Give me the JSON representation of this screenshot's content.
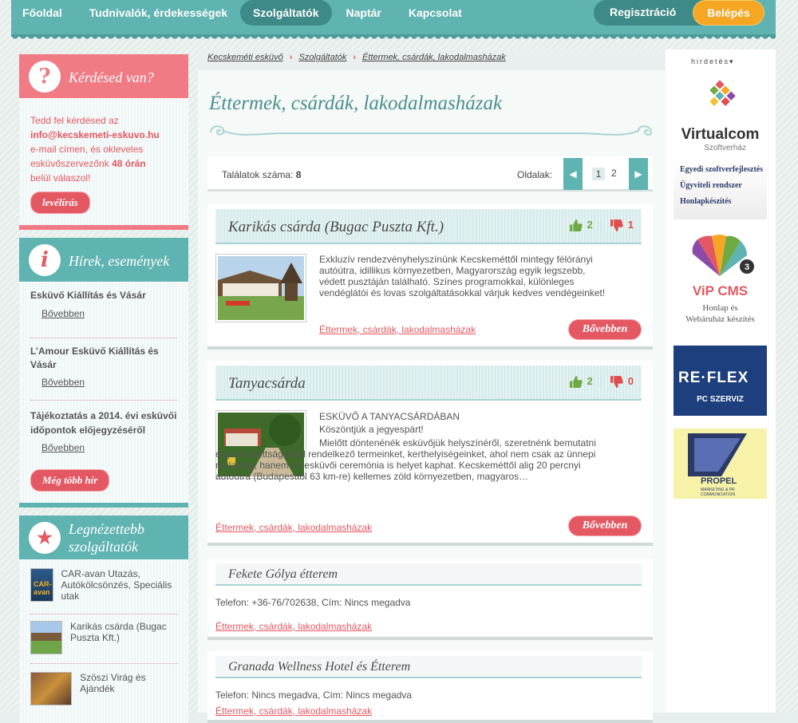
{
  "nav": {
    "items": [
      "Főoldal",
      "Tudnivalók, érdekességek",
      "Szolgáltatók",
      "Naptár",
      "Kapcsolat"
    ],
    "register": "Regisztráció",
    "login": "Belépés"
  },
  "question": {
    "title": "Kérdésed van?",
    "text1": "Tedd fel kérdésed az",
    "email": "info@kecskemeti-eskuvo.hu",
    "text2": "e-mail címen, és okleveles esküvőszervezőnk",
    "hours": "48 órán",
    "text3": "belül válaszol!",
    "button": "levélírás"
  },
  "news": {
    "title": "Hírek, események",
    "items": [
      {
        "title": "Esküvő Kiállítás és Vásár",
        "more": "Bővebben"
      },
      {
        "title": "L’Amour Esküvő Kiállítás és Vásár",
        "more": "Bővebben"
      },
      {
        "title": "Tájékoztatás a 2014. évi esküvői időpontok előjegyzéséről",
        "more": "Bővebben"
      }
    ],
    "button": "Még több hír"
  },
  "popular": {
    "title1": "Legnézettebb",
    "title2": "szolgáltatók",
    "items": [
      "CAR-avan Utazás, Autókölcsönzés, Speciális utak",
      "Karikás csárda (Bugac Puszta Kft.)",
      "Szöszi Virág és Ajándék"
    ]
  },
  "breadcrumb": [
    "Kecskeméti esküvő",
    "Szolgáltatók",
    "Éttermek, csárdák, lakodalmasházak"
  ],
  "page_title": "Éttermek, csárdák, lakodalmasházak",
  "results": {
    "label": "Találatok száma:",
    "count": "8",
    "pages_label": "Oldalak:",
    "pages": [
      "1",
      "2"
    ]
  },
  "listings": [
    {
      "name": "Karikás csárda (Bugac Puszta Kft.)",
      "up": "2",
      "down": "1",
      "desc": "Exkluzív rendezvényhelyszínünk Kecskeméttől mintegy félórányi autóútra, idillikus környezetben, Magyarország egyik legszebb, védett pusztáján található. Színes programokkal, különleges vendéglátói és lovas szolgáltatásokkal várjuk kedves vendégeinket!",
      "category": "Éttermek, csárdák, lakodalmasházak",
      "more": "Bővebben"
    },
    {
      "name": "Tanyacsárda",
      "up": "2",
      "down": "0",
      "heading": "ESKÜVŐ A TANYACSÁRDÁBAN",
      "sub": "Köszöntjük a jegyespárt!",
      "desc": "Mielőtt döntenénék esküvőjük helyszínéről, szeretnénk bemutatni egyedi adottságokkal rendelkező termeinket, kerthelyiségeinket, ahol nem csak az ünnepi mulatság, hanem az esküvői ceremónia is helyet kaphat. Kecskeméttől alig 20 percnyi autóútra (Budapesttől 63 km-re) kellemes zöld környezetben, magyaros…",
      "category": "Éttermek, csárdák, lakodalmasházak",
      "more": "Bővebben"
    },
    {
      "name": "Fekete Gólya étterem",
      "info": "Telefon: +36-76/702638, Cím: Nincs megadva",
      "category": "Éttermek, csárdák, lakodalmasházak"
    },
    {
      "name": "Granada Wellness Hotel és Étterem",
      "info": "Telefon: Nincs megadva, Cím: Nincs megadva",
      "category": "Éttermek, csárdák, lakodalmasházak"
    }
  ],
  "ads": {
    "label": "hirdetés",
    "virtualcom": {
      "name": "Virtualcom",
      "sub": "Szoftverház",
      "lines": [
        "Egyedi szoftverfejlesztés",
        "Ügyviteli rendszer",
        "Honlapkészítés"
      ]
    },
    "vip": {
      "name": "ViP CMS",
      "badge": "3",
      "line1": "Honlap és",
      "line2": "Webáruház készítés"
    },
    "reflex": {
      "name": "RE·FLEX",
      "sub": "PC SZERVIZ"
    },
    "propel": {
      "name": "PROPEL",
      "sub": "MARKETING & PR COMMUNICATION"
    }
  },
  "colors": {
    "teal": "#5fb3b1",
    "pink": "#e35862",
    "orange": "#f5a623"
  }
}
